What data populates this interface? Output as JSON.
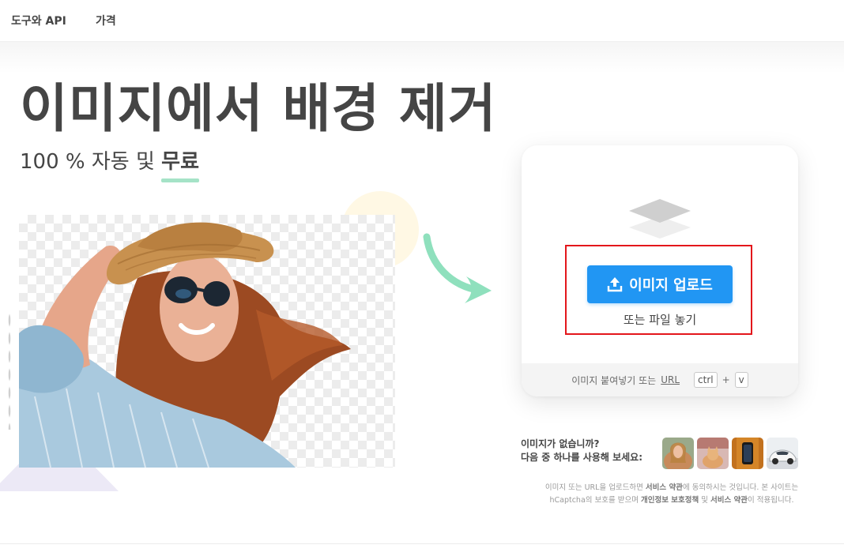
{
  "nav": {
    "items": [
      {
        "label": "도구와 API"
      },
      {
        "label": "가격"
      }
    ]
  },
  "hero": {
    "title": "이미지에서 배경 제거",
    "subtitle_prefix": "100 % 자동 및",
    "subtitle_highlight": "무료"
  },
  "upload": {
    "button_label": "이미지 업로드",
    "drop_text": "또는 파일 놓기",
    "paste_text": "이미지 붙여넣기 또는",
    "url_label": "URL",
    "shortcut_keys": [
      "ctrl",
      "+",
      "v"
    ],
    "icon": "upload-icon"
  },
  "samples": {
    "line1": "이미지가 없습니까?",
    "line2": "다음 중 하나를 사용해 보세요:",
    "thumbnails": [
      "woman-sample",
      "cat-sample",
      "phone-sample",
      "car-sample"
    ]
  },
  "legal": {
    "t1": "이미지 또는 URL을 업로드하면 ",
    "t2": "서비스 약관",
    "t3": "에 동의하시는 것입니다. 본 사이트는",
    "t4": "hCaptcha의 보호를 받으며 ",
    "t5": "개인정보 보호정책",
    "t6": " 및 ",
    "t7": "서비스 약관",
    "t8": "이 적용됩니다."
  },
  "colors": {
    "primary": "#2196f3",
    "highlight_border": "#e3161b",
    "underline": "#a5e3c7",
    "arrow": "#8fe0bd",
    "text": "#454545"
  }
}
